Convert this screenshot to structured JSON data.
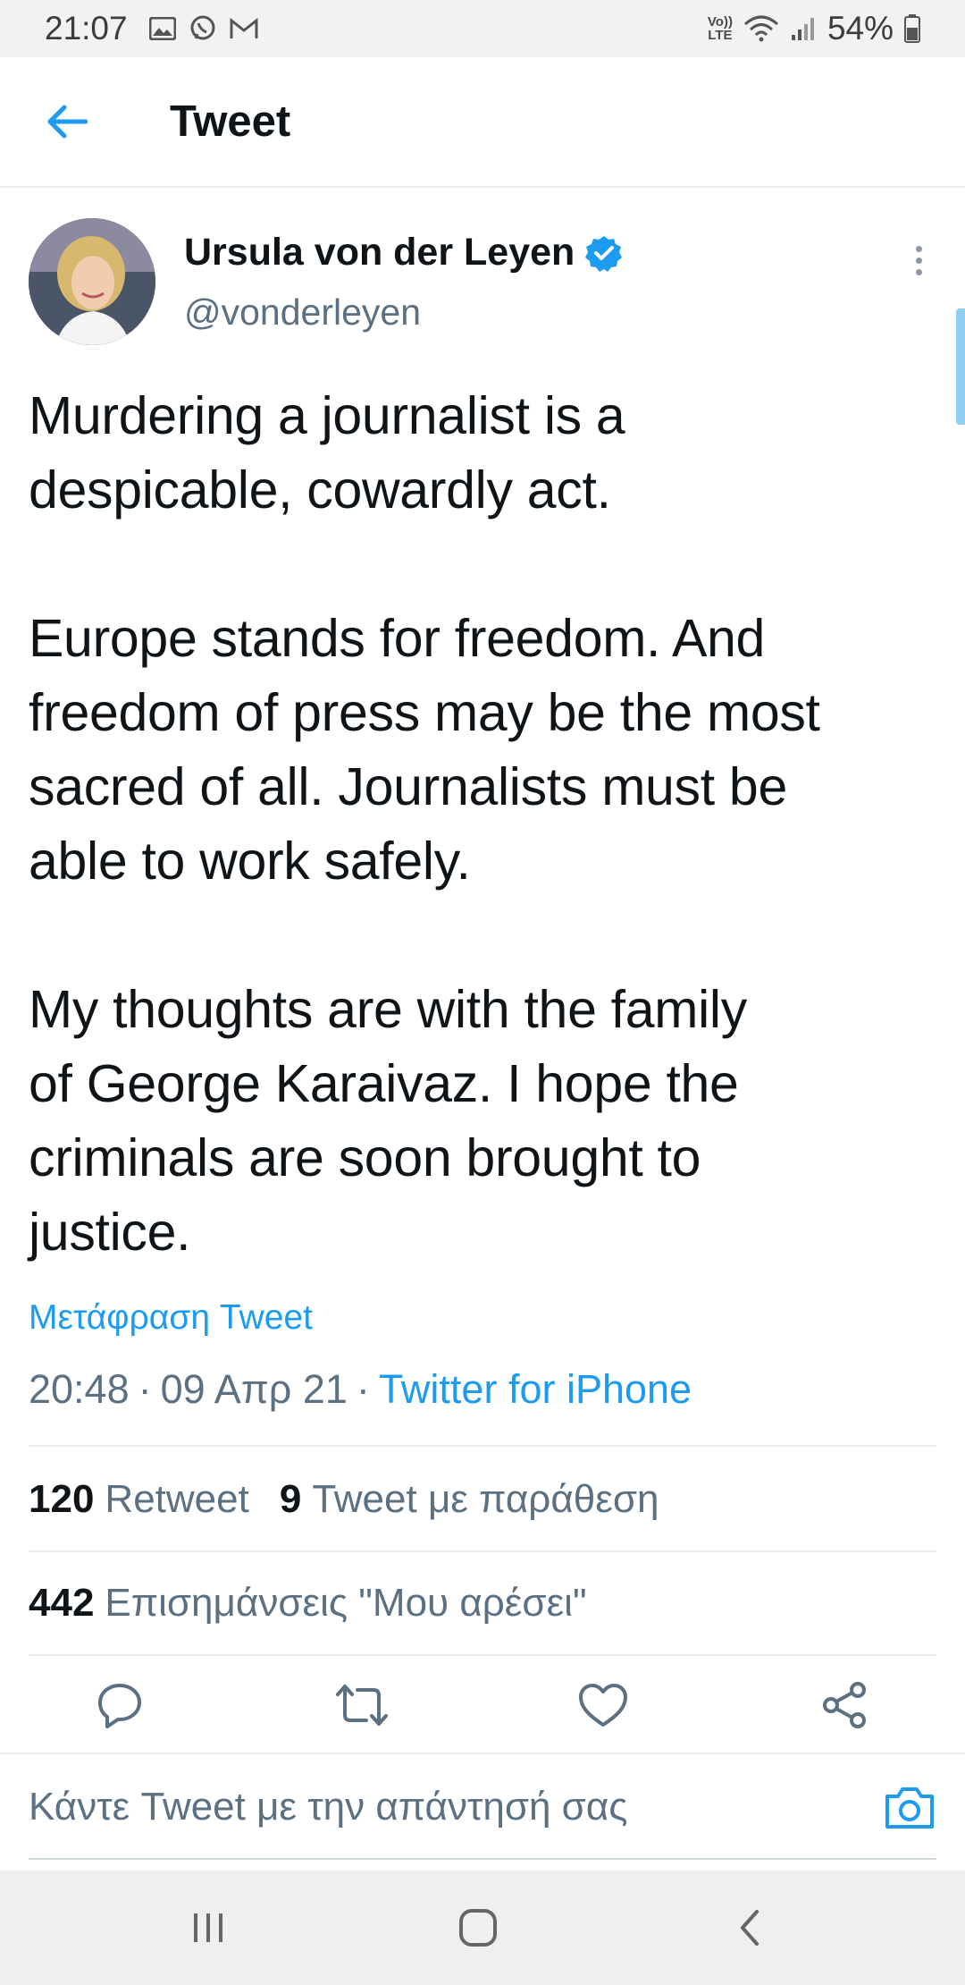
{
  "status_bar": {
    "time": "21:07",
    "volte_top": "Vo))",
    "volte_bottom": "LTE",
    "battery": "54%"
  },
  "header": {
    "title": "Tweet"
  },
  "tweet": {
    "author_name": "Ursula von der Leyen",
    "author_handle": "@vonderleyen",
    "text": "Murdering a journalist is a\ndespicable, cowardly act.\n\nEurope stands for freedom. And\nfreedom of press may be the most\nsacred of all. Journalists must be\nable to work safely.\n\nMy thoughts are with the family\nof George Karaivaz. I hope the\ncriminals are soon brought to\njustice.",
    "translate_label": "Μετάφραση Tweet",
    "time": "20:48",
    "date": "09 Απρ 21",
    "source": "Twitter for iPhone",
    "separator": "·"
  },
  "stats": {
    "retweets_count": "120",
    "retweets_label": "Retweet",
    "quotes_count": "9",
    "quotes_label": "Tweet με παράθεση",
    "likes_count": "442",
    "likes_label": "Επισημάνσεις \"Μου αρέσει\""
  },
  "reply": {
    "placeholder": "Κάντε Tweet με την απάντησή σας"
  },
  "colors": {
    "accent": "#1d9bf0",
    "text": "#0f1419",
    "secondary": "#5b7083",
    "divider": "#e6ecf0"
  },
  "icons": {
    "back": "arrow-left-icon",
    "verified": "verified-badge-icon",
    "more": "more-vertical-icon",
    "reply": "reply-icon",
    "retweet": "retweet-icon",
    "like": "heart-icon",
    "share": "share-icon",
    "camera": "camera-icon",
    "recents": "recents-icon",
    "home": "home-icon",
    "nav_back": "nav-back-icon"
  }
}
